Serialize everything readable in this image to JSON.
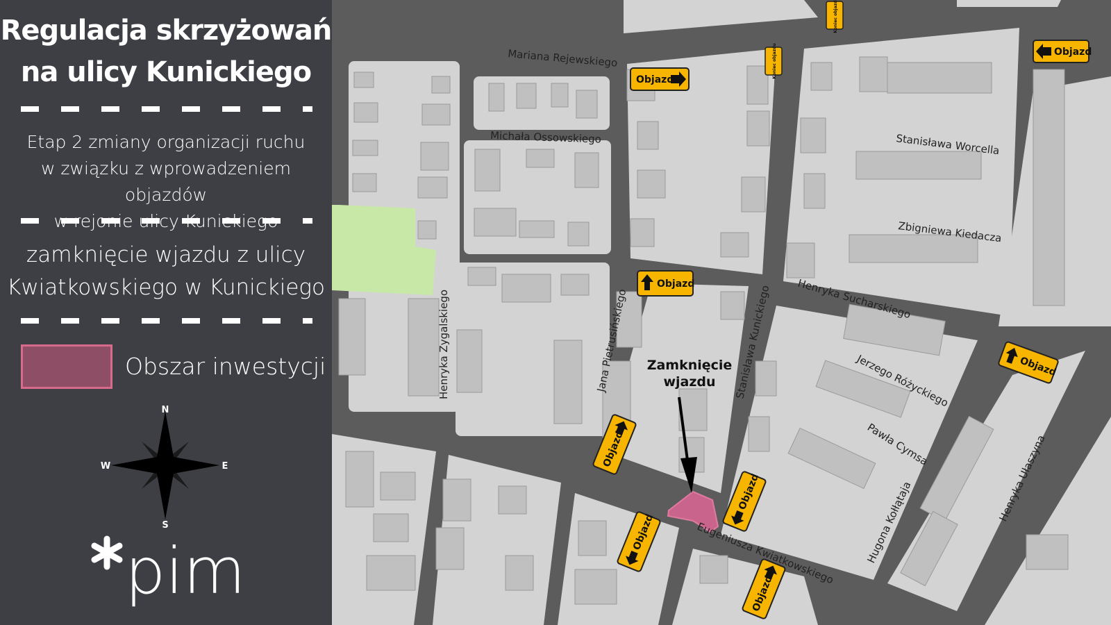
{
  "panel": {
    "title_line1": "Regulacja skrzyżowań",
    "title_line2": "na ulicy Kunickiego",
    "stage_line1": "Etap 2 zmiany organizacji ruchu",
    "stage_line2": "w związku z wprowadzeniem objazdów",
    "stage_line3": "w rejonie ulicy Kunickiego",
    "closure_line1": "zamknięcie wjazdu z ulicy",
    "closure_line2": "Kwiatkowskiego w Kunickiego",
    "legend_label": "Obszar inwestycji",
    "compass": {
      "n": "N",
      "s": "S",
      "e": "E",
      "w": "W"
    },
    "logo_text": "pim"
  },
  "map": {
    "colors": {
      "road": "#5c5c5c",
      "block": "#d3d3d3",
      "building": "#c0c0c0",
      "green": "#c8e8a8",
      "investment": "#c9658d",
      "sign": "#f7b500"
    },
    "streets": [
      "Mariana Rejewskiego",
      "Michała Ossowskiego",
      "Stanisława Worcella",
      "Zbigniewa Kiedacza",
      "Henryka Sucharskiego",
      "Jerzego Różyckiego",
      "Pawła Cymsa",
      "Hugona Kołłątaja",
      "Henryka Ułaszyna",
      "Stanisława Kunickiego",
      "Jana Pietrusińskiego",
      "Henryka Zygalskiego",
      "Eugeniusza Kwiatkowskiego"
    ],
    "signs": {
      "detour": "Objazd",
      "detour_end": "Koniec objazdu"
    },
    "callout_line1": "Zamknięcie",
    "callout_line2": "wjazdu"
  }
}
